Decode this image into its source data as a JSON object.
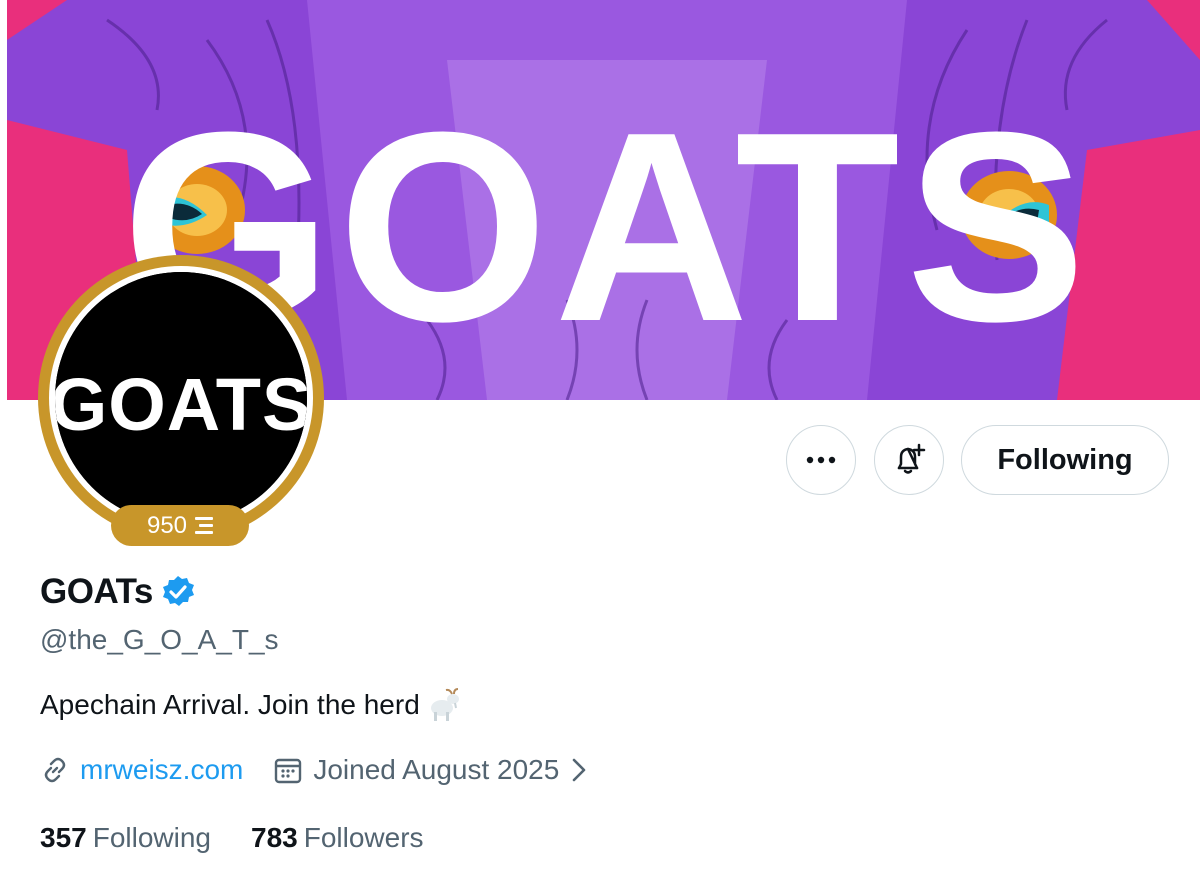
{
  "banner": {
    "wordmark": "GOATS",
    "bg_color": "#e92f7c",
    "fur_color": "#8a45d6"
  },
  "avatar": {
    "wordmark": "GOATS",
    "ring_color": "#c8962a"
  },
  "badge": {
    "value": "950",
    "icon": "stack-icon"
  },
  "actions": {
    "more_icon": "more-icon",
    "notify_icon": "bell-plus-icon",
    "follow_label": "Following"
  },
  "profile": {
    "display_name": "GOATs",
    "verified_icon": "verified-badge-icon",
    "handle": "@the_G_O_A_T_s",
    "bio": "Apechain Arrival. Join the herd",
    "bio_emoji": "goat-icon",
    "link": "mrweisz.com",
    "joined": "Joined August 2025"
  },
  "stats": {
    "following_count": "357",
    "following_label": "Following",
    "followers_count": "783",
    "followers_label": "Followers"
  }
}
